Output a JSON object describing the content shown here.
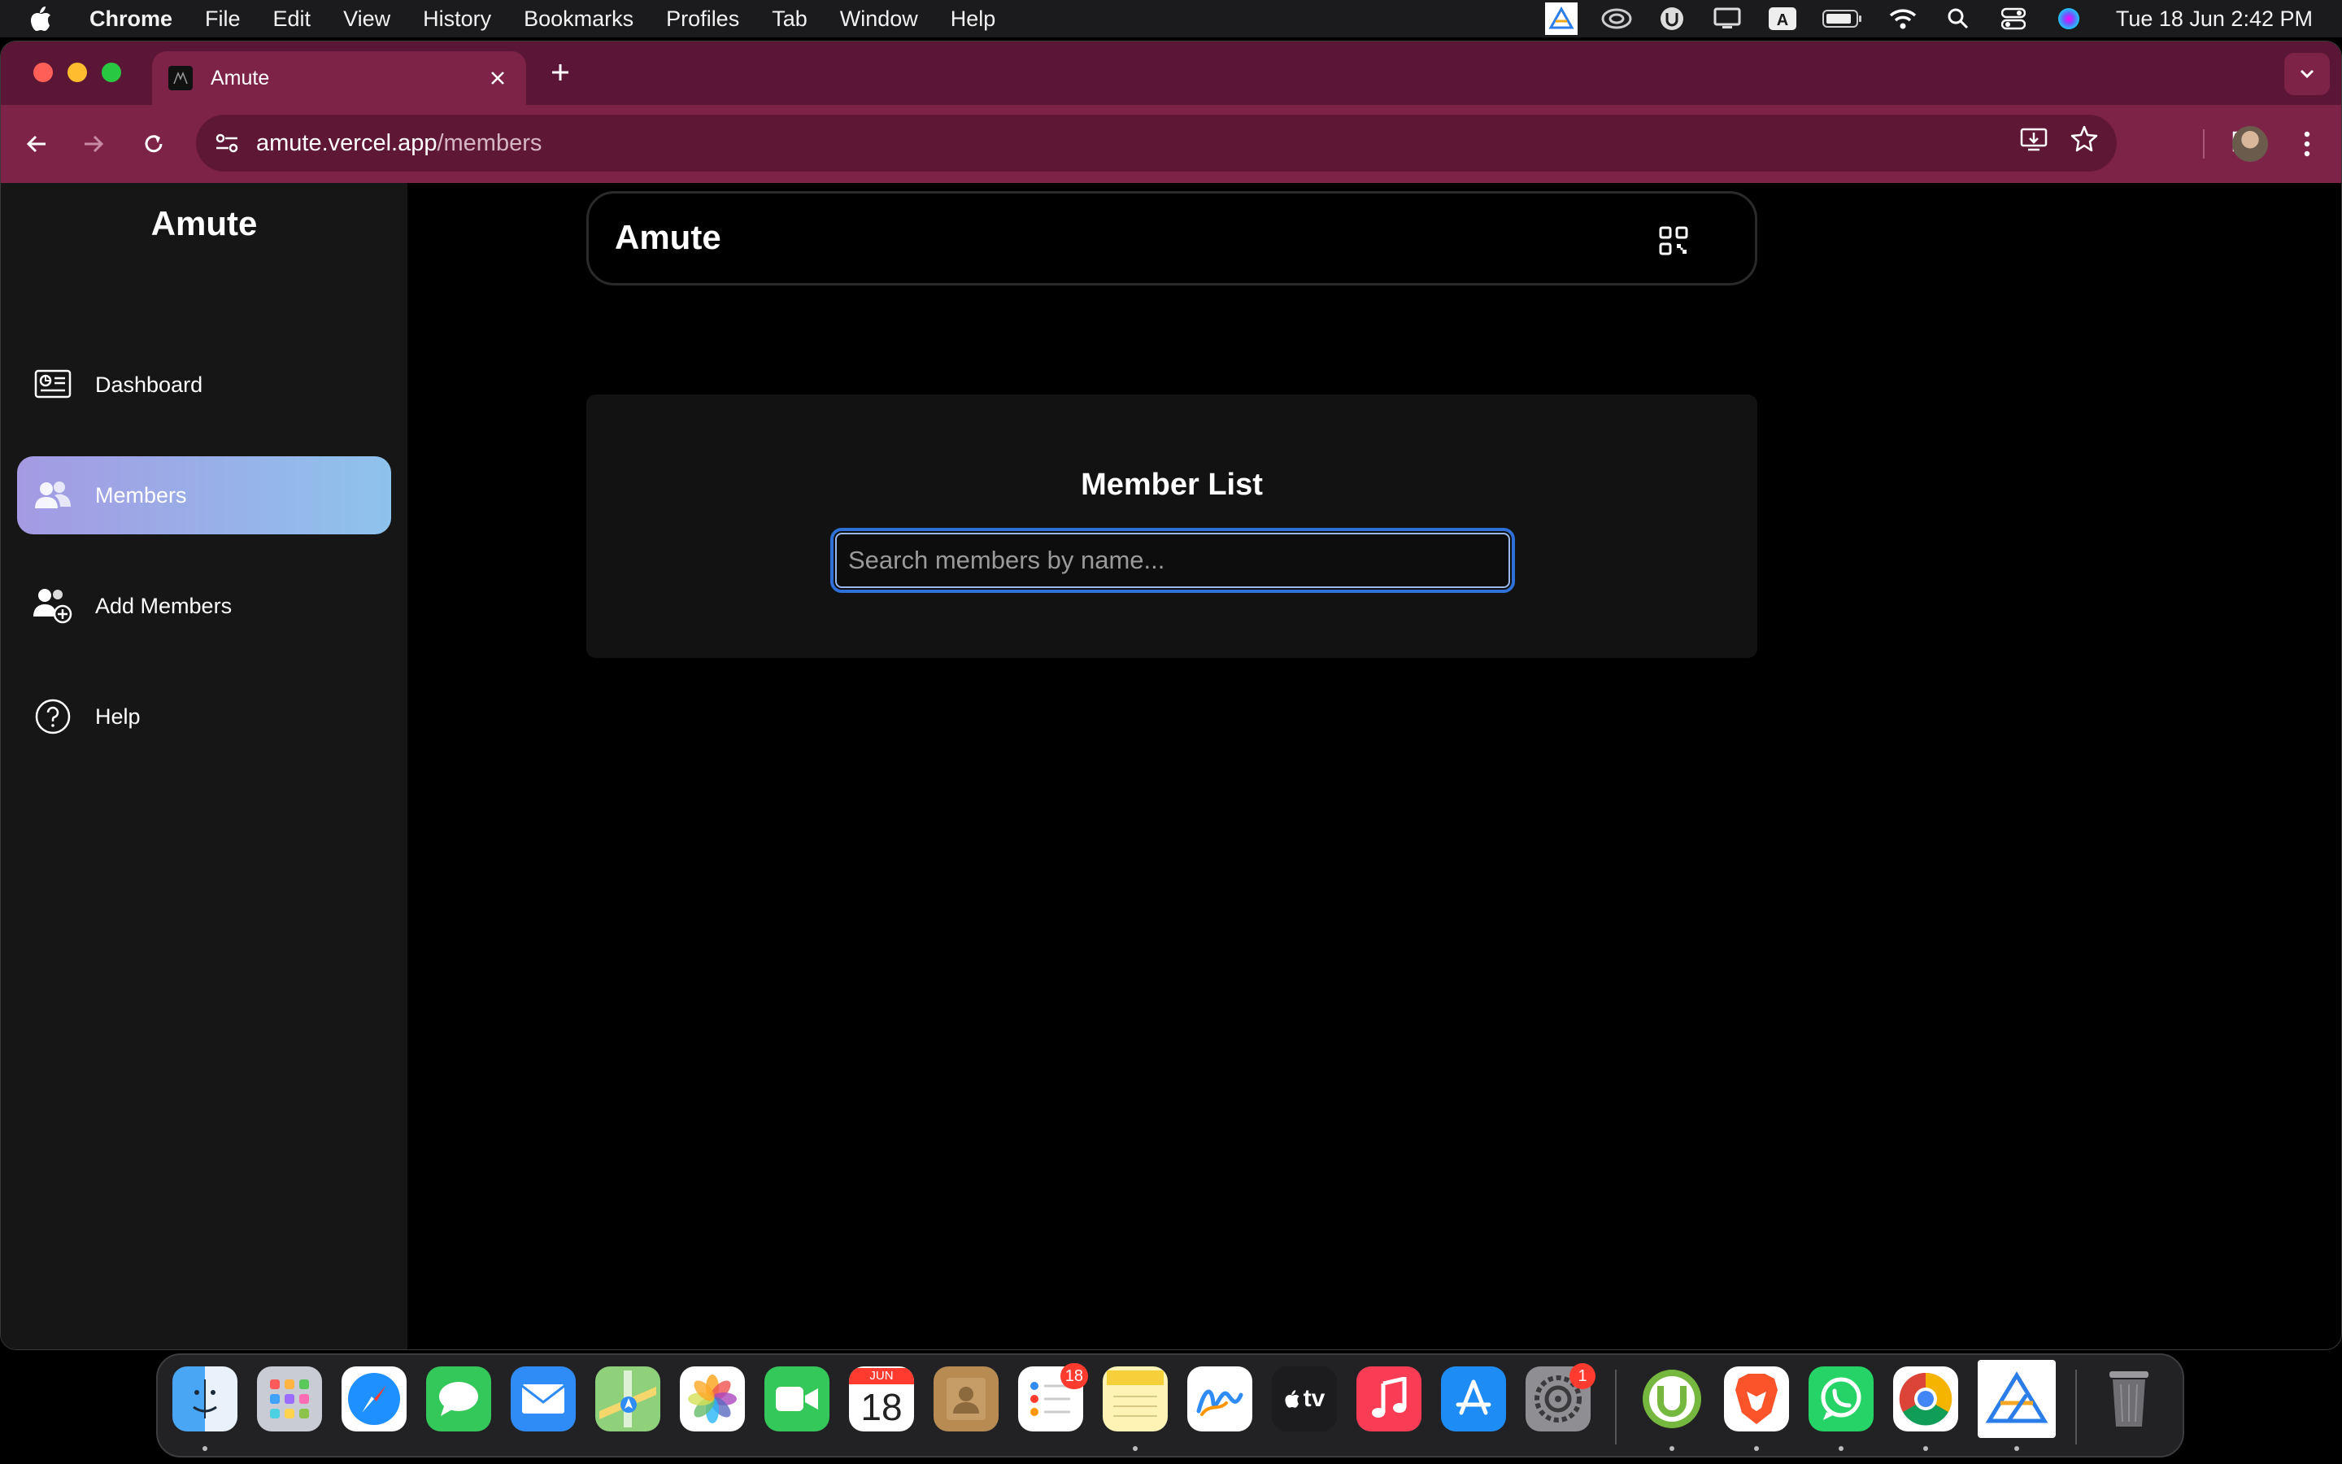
{
  "menubar": {
    "app_name": "Chrome",
    "menus": [
      "File",
      "Edit",
      "View",
      "History",
      "Bookmarks",
      "Profiles",
      "Tab",
      "Window",
      "Help"
    ],
    "clock": "Tue 18 Jun  2:42 PM",
    "tray_icons": [
      "keystroke-app-icon",
      "creative-cloud-icon",
      "utorrent-icon",
      "display-icon",
      "keyboard-input-icon",
      "battery-icon",
      "wifi-icon",
      "spotlight-search-icon",
      "control-center-icon",
      "siri-icon"
    ]
  },
  "browser": {
    "tab_title": "Amute",
    "url_host": "amute.vercel.app",
    "url_path": "/members",
    "accent_color": "#7d2348",
    "tabstrip_color": "#5c1635"
  },
  "sidebar": {
    "brand": "Amute",
    "items": [
      {
        "label": "Dashboard",
        "icon": "dashboard-icon",
        "active": false
      },
      {
        "label": "Members",
        "icon": "members-icon",
        "active": true
      },
      {
        "label": "Add Members",
        "icon": "add-member-icon",
        "active": false
      },
      {
        "label": "Help",
        "icon": "help-icon",
        "active": false
      }
    ]
  },
  "header": {
    "title": "Amute",
    "qr_icon": "qr-code-icon"
  },
  "main": {
    "card_title": "Member List",
    "search_placeholder": "Search members by name...",
    "search_value": ""
  },
  "dock": {
    "apps": [
      {
        "name": "finder"
      },
      {
        "name": "launchpad"
      },
      {
        "name": "safari"
      },
      {
        "name": "messages"
      },
      {
        "name": "mail"
      },
      {
        "name": "maps"
      },
      {
        "name": "photos"
      },
      {
        "name": "facetime"
      },
      {
        "name": "calendar",
        "month": "JUN",
        "day": "18"
      },
      {
        "name": "contacts"
      },
      {
        "name": "reminders",
        "badge": "18"
      },
      {
        "name": "notes"
      },
      {
        "name": "freeform"
      },
      {
        "name": "apple-tv",
        "label": "tv"
      },
      {
        "name": "music"
      },
      {
        "name": "app-store"
      },
      {
        "name": "system-settings",
        "badge": "1"
      },
      {
        "name": "utorrent"
      },
      {
        "name": "brave"
      },
      {
        "name": "whatsapp"
      },
      {
        "name": "chrome"
      },
      {
        "name": "keystroke"
      },
      {
        "name": "trash"
      }
    ]
  }
}
